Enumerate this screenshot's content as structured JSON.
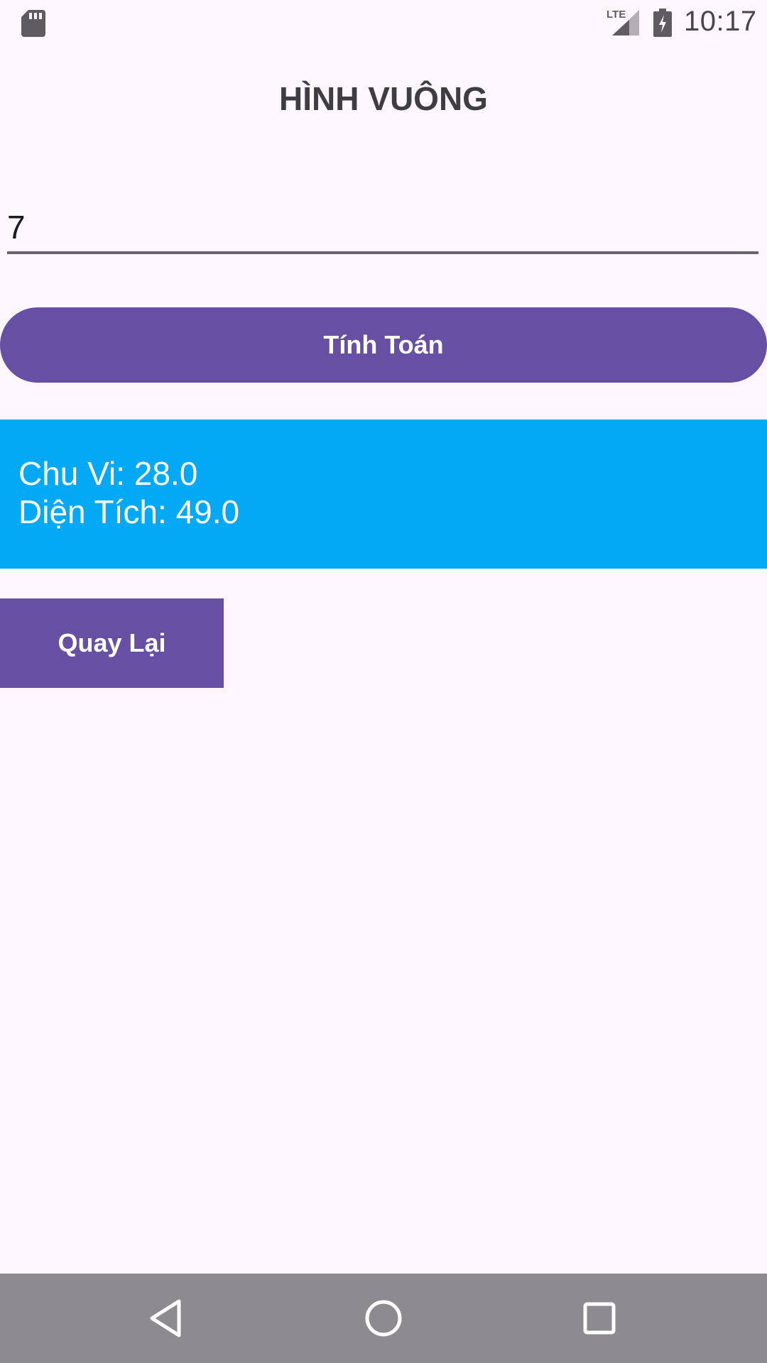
{
  "status_bar": {
    "time": "10:17",
    "network": "LTE",
    "icons": [
      "sd-card-icon",
      "lte-signal-icon",
      "battery-charging-icon"
    ]
  },
  "header": {
    "title": "HÌNH VUÔNG"
  },
  "input": {
    "value": "7"
  },
  "actions": {
    "calculate_label": "Tính Toán",
    "back_label": "Quay Lại"
  },
  "results": {
    "perimeter": "Chu Vi: 28.0",
    "area": "Diện Tích: 49.0"
  },
  "nav_bar": {
    "icons": [
      "back-triangle-icon",
      "home-circle-icon",
      "recents-square-icon"
    ]
  },
  "colors": {
    "background": "#fdf7fd",
    "primary": "#6750a4",
    "results_background": "#03a9f4",
    "nav_bar": "#8e8b90"
  }
}
